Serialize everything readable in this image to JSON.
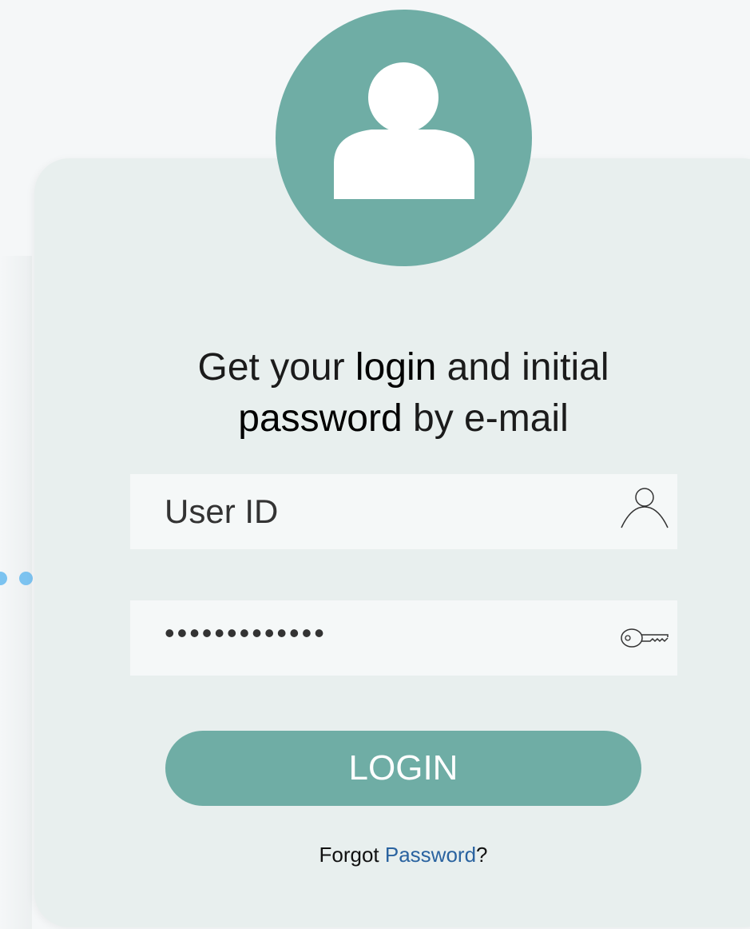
{
  "heading": {
    "part1": "Get your ",
    "login_word": "login",
    "part2": " and initial ",
    "password_word": "password",
    "part3": " by e-mail"
  },
  "user_field": {
    "placeholder": "User ID",
    "icon": "user-outline-icon"
  },
  "password_field": {
    "value": "•••••••••••••",
    "icon": "key-icon"
  },
  "login_button": {
    "label": "LOGIN"
  },
  "forgot": {
    "prefix": "Forgot ",
    "link_text": "Password",
    "suffix": "?"
  },
  "colors": {
    "accent": "#6fada5",
    "card_background": "#e8efee",
    "field_background": "#f5f8f8",
    "link": "#2a63a0",
    "dots": "#7cc3f0"
  },
  "avatar": {
    "icon": "user-avatar-icon"
  }
}
